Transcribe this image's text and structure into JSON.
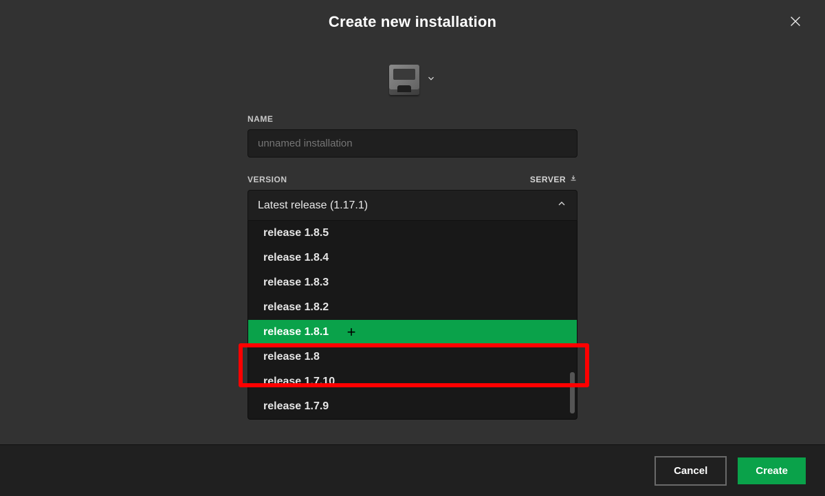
{
  "header": {
    "title": "Create new installation"
  },
  "icon": {
    "name": "furnace-icon"
  },
  "fields": {
    "name_label": "NAME",
    "name_placeholder": "unnamed installation",
    "name_value": "",
    "version_label": "VERSION",
    "server_label": "SERVER"
  },
  "version_select": {
    "selected": "Latest release (1.17.1)",
    "expanded": true,
    "options": [
      "release 1.8.5",
      "release 1.8.4",
      "release 1.8.3",
      "release 1.8.2",
      "release 1.8.1",
      "release 1.8",
      "release 1.7.10",
      "release 1.7.9"
    ],
    "highlight_index": 4
  },
  "footer": {
    "cancel_label": "Cancel",
    "create_label": "Create"
  }
}
